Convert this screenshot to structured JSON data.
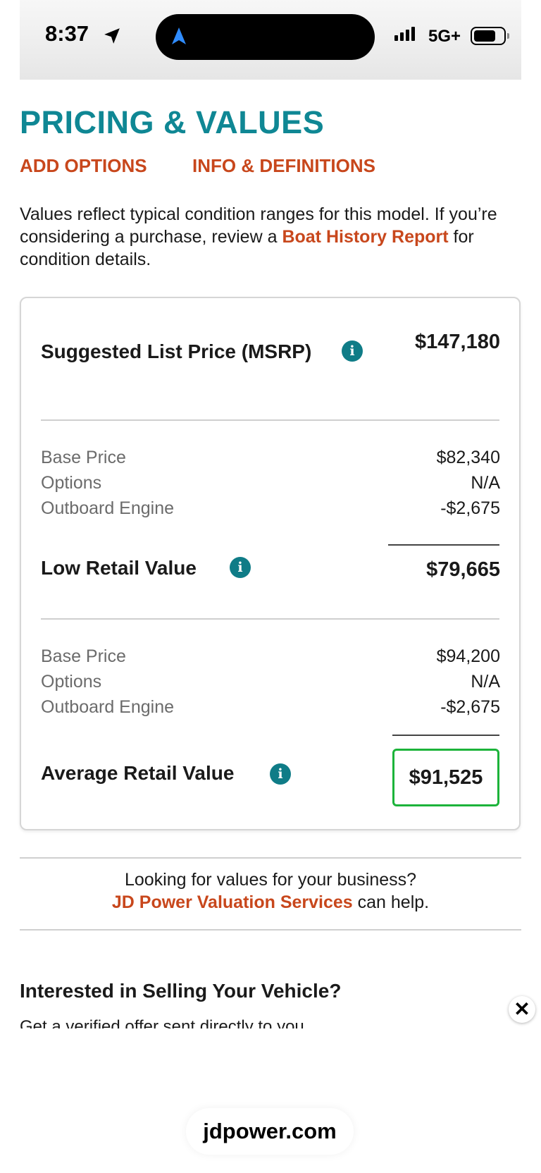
{
  "status_bar": {
    "time": "8:37",
    "network": "5G+"
  },
  "header": {
    "title": "PRICING & VALUES",
    "tabs": [
      {
        "label": "ADD OPTIONS"
      },
      {
        "label": "INFO & DEFINITIONS"
      }
    ]
  },
  "intro": {
    "text_before": "Values reflect typical condition ranges for this model. If you’re considering a purchase, review a ",
    "link": "Boat History Report",
    "text_after": " for condition details."
  },
  "pricing": {
    "msrp": {
      "label": "Suggested List Price (MSRP)",
      "value": "$147,180"
    },
    "low": {
      "rows": [
        {
          "label": "Base Price",
          "value": "$82,340"
        },
        {
          "label": "Options",
          "value": "N/A"
        },
        {
          "label": "Outboard Engine",
          "value": "-$2,675"
        }
      ],
      "label": "Low Retail Value",
      "value": "$79,665"
    },
    "average": {
      "rows": [
        {
          "label": "Base Price",
          "value": "$94,200"
        },
        {
          "label": "Options",
          "value": "N/A"
        },
        {
          "label": "Outboard Engine",
          "value": "-$2,675"
        }
      ],
      "label": "Average Retail Value",
      "value": "$91,525"
    },
    "info_icon": "i"
  },
  "business": {
    "line1": "Looking for values for your business?",
    "link": "JD Power Valuation Services",
    "line2_rest": " can help."
  },
  "sell": {
    "title": "Interested in Selling Your Vehicle?",
    "subtitle": "Get a verified offer sent directly to you"
  },
  "close_icon": "✕",
  "browser": {
    "url": "jdpower.com"
  },
  "colors": {
    "teal": "#0f8794",
    "orange": "#c8471c",
    "highlight": "#1cb33a"
  }
}
